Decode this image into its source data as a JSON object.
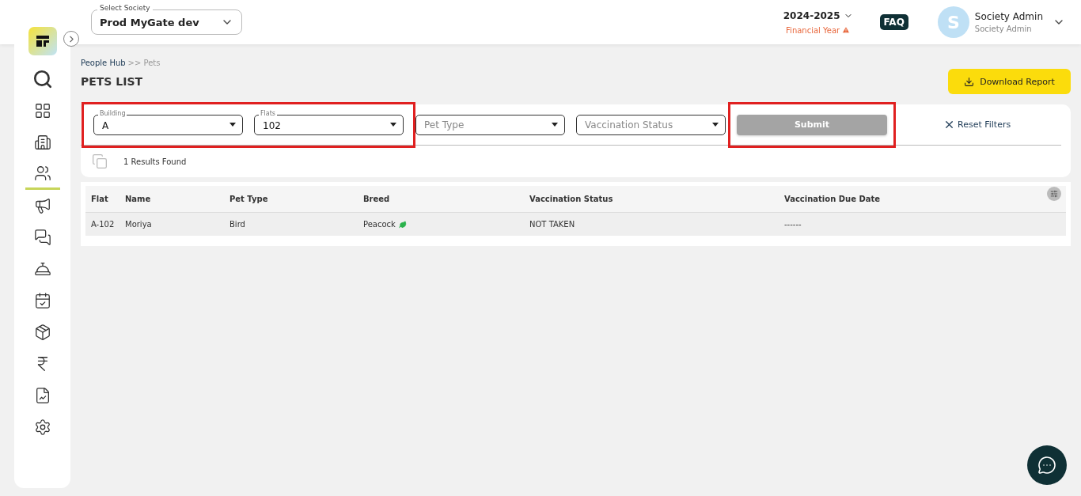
{
  "header": {
    "society_select": {
      "label": "Select Society",
      "value": "Prod MyGate dev"
    },
    "year": {
      "value": "2024-2025",
      "caption": "Financial Year"
    },
    "faq": "FAQ",
    "user": {
      "initial": "S",
      "name": "Society Admin",
      "role": "Society Admin"
    }
  },
  "sidebar": {
    "items": [
      {
        "kind": "search",
        "selected": false
      },
      {
        "kind": "dashboard",
        "selected": false
      },
      {
        "kind": "building",
        "selected": false
      },
      {
        "kind": "people",
        "selected": true
      },
      {
        "kind": "megaphone",
        "selected": false
      },
      {
        "kind": "chat",
        "selected": false
      },
      {
        "kind": "desk",
        "selected": false
      },
      {
        "kind": "calendar",
        "selected": false
      },
      {
        "kind": "package",
        "selected": false
      },
      {
        "kind": "rupee",
        "selected": false
      },
      {
        "kind": "report",
        "selected": false
      },
      {
        "kind": "settings",
        "selected": false
      }
    ]
  },
  "breadcrumb": {
    "parent": "People Hub",
    "current": ">> Pets"
  },
  "page_title": "PETS LIST",
  "download_button": "Download Report",
  "filter_groups": [
    {
      "highlighted": true,
      "fields": [
        {
          "label": "Building",
          "value": "A"
        },
        {
          "label": "Flats",
          "value": "102"
        }
      ]
    },
    {
      "highlighted": false,
      "fields": [
        {
          "placeholder": "Pet Type"
        },
        {
          "placeholder": "Vaccination Status"
        }
      ]
    }
  ],
  "submit": {
    "label": "Submit",
    "disabled": true,
    "highlighted": true
  },
  "reset_filters": "Reset Filters",
  "results_count": "1 Results Found",
  "table": {
    "columns": [
      "Flat",
      "Name",
      "Pet Type",
      "Breed",
      "Vaccination Status",
      "Vaccination Due Date"
    ],
    "rows": [
      {
        "cells": [
          "A-102",
          "Moriya",
          "Bird",
          "Peacock",
          "NOT TAKEN",
          "------"
        ]
      }
    ]
  }
}
